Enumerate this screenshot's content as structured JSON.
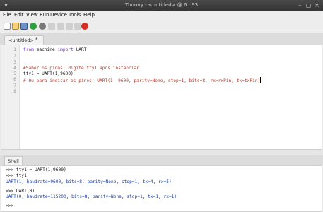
{
  "window": {
    "title": "Thonny - <untitled> @ 6 : 93"
  },
  "menu": [
    "File",
    "Edit",
    "View",
    "Run",
    "Device",
    "Tools",
    "Help"
  ],
  "toolbar": {
    "icons": [
      "new-file-icon",
      "open-file-icon",
      "save-file-icon",
      "run-icon",
      "debug-icon",
      "step-over-icon",
      "step-into-icon",
      "step-out-icon",
      "resume-icon",
      "stop-icon"
    ],
    "stop_color": "#d62d20",
    "run_color": "#2e9e3f"
  },
  "editor": {
    "tab_label": "<untitled>",
    "tab_close": "*",
    "line_numbers": [
      "1",
      "2",
      "3",
      "4",
      "5",
      "6",
      "7",
      "8"
    ],
    "lines": [
      {
        "kw1": "from",
        "t1": " machine ",
        "kw2": "import",
        "t2": " UART"
      },
      {
        "text": ""
      },
      {
        "text": ""
      },
      {
        "comment": "#Saber os pinos: digite tty1 apos instanciar"
      },
      {
        "text": "tty1 = UART(1,9600)"
      },
      {
        "comment": "# Ou para indicar os pinos: UART(1, 9600, parity=None, stop=1, bits=8, rx=rxPin, tx=txPin)"
      },
      {
        "text": ""
      },
      {
        "text": ""
      }
    ]
  },
  "shell": {
    "tab_label": "Shell",
    "lines": [
      {
        "kind": "prompt",
        "text": ">>> tty1 = UART(1,9600)"
      },
      {
        "kind": "prompt",
        "text": ">>> tty1"
      },
      {
        "kind": "out",
        "text": "UART(1, baudrate=9600, bits=8, parity=None, stop=1, tx=4, rx=5)"
      },
      {
        "kind": "prompt",
        "text": ">>> UART(0)"
      },
      {
        "kind": "out",
        "text": "UART(0, baudrate=115200, bits=8, parity=None, stop=1, tx=1, rx=1)"
      },
      {
        "kind": "prompt",
        "text": ">>>"
      }
    ]
  }
}
